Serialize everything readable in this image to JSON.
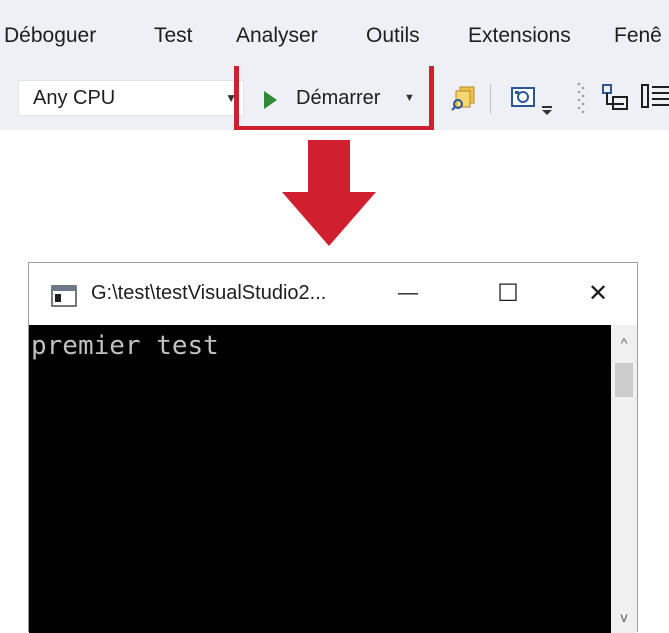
{
  "menubar": {
    "items": [
      "Déboguer",
      "Test",
      "Analyser",
      "Outils",
      "Extensions",
      "Fenê"
    ]
  },
  "toolbar": {
    "platform": "Any CPU",
    "start_label": "Démarrer",
    "highlight_color": "#d0202f"
  },
  "console": {
    "title": "G:\\test\\testVisualStudio2...",
    "output": "premier test",
    "minimize_glyph": "—",
    "maximize_glyph": "☐",
    "close_glyph": "✕",
    "scroll_up_glyph": "^",
    "scroll_down_glyph": "v"
  },
  "icons": {
    "play": "play-icon",
    "arrow": "red-down-arrow"
  }
}
